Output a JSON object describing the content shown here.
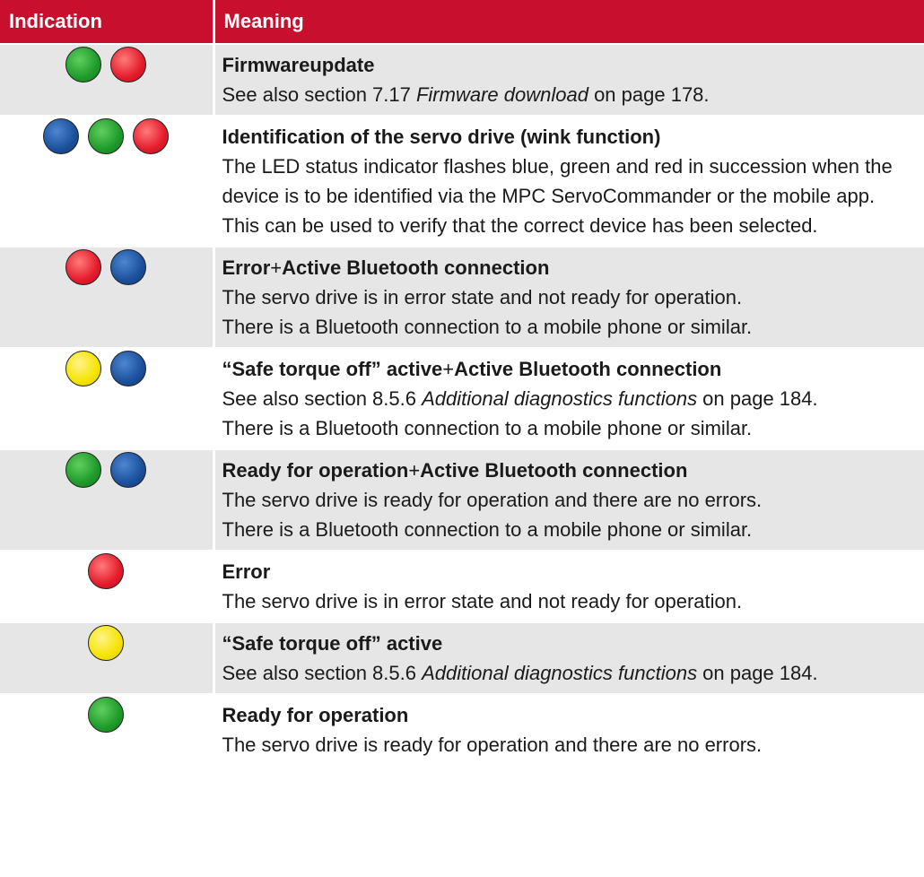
{
  "header": {
    "indication": "Indication",
    "meaning": "Meaning"
  },
  "colors": {
    "header_bg": "#c8102e",
    "row_shade": "#e6e6e6",
    "green": "#1e9a2a",
    "red": "#e41b2b",
    "blue": "#1b4f9b",
    "yellow": "#f5e400"
  },
  "rows": [
    {
      "leds": [
        "green",
        "red"
      ],
      "title": "Firmwareupdate",
      "lines": [
        {
          "pre": "See also section 7.17 ",
          "em": "Firmware download",
          "post": " on page 178."
        }
      ]
    },
    {
      "leds": [
        "blue",
        "green",
        "red"
      ],
      "title": "Identification of the servo drive (wink function)",
      "lines": [
        {
          "pre": "The LED status indicator flashes blue, green and red in succession when the device is to be identified via the MPC ServoCommander or the mobile app. This can be used to verify that the correct device has been selected."
        }
      ]
    },
    {
      "leds": [
        "red",
        "blue"
      ],
      "title_a": "Error",
      "title_plus": "+",
      "title_b": "Active Bluetooth connection",
      "lines": [
        {
          "pre": "The servo drive is in error state and not ready for operation."
        },
        {
          "pre": "There is a Bluetooth connection to a mobile phone or similar."
        }
      ]
    },
    {
      "leds": [
        "yellow",
        "blue"
      ],
      "title_a": "“Safe torque off” active",
      "title_plus": "+",
      "title_b": "Active Bluetooth connection",
      "lines": [
        {
          "pre": "See also section 8.5.6 ",
          "em": "Additional diagnostics functions",
          "post": " on page 184."
        },
        {
          "pre": "There is a Bluetooth connection to a mobile phone or similar."
        }
      ]
    },
    {
      "leds": [
        "green",
        "blue"
      ],
      "title_a": "Ready for operation",
      "title_plus": "+",
      "title_b": "Active Bluetooth connection",
      "lines": [
        {
          "pre": "The servo drive is ready for operation and there are no errors."
        },
        {
          "pre": "There is a Bluetooth connection to a mobile phone or similar."
        }
      ]
    },
    {
      "leds": [
        "red"
      ],
      "title": "Error",
      "lines": [
        {
          "pre": "The servo drive is in error state and not ready for operation."
        }
      ]
    },
    {
      "leds": [
        "yellow"
      ],
      "title": "“Safe torque off” active",
      "lines": [
        {
          "pre": "See also section 8.5.6 ",
          "em": "Additional diagnostics functions",
          "post": " on page 184."
        }
      ]
    },
    {
      "leds": [
        "green"
      ],
      "title": "Ready for operation",
      "lines": [
        {
          "pre": "The servo drive is ready for operation and there are no errors."
        }
      ]
    }
  ]
}
